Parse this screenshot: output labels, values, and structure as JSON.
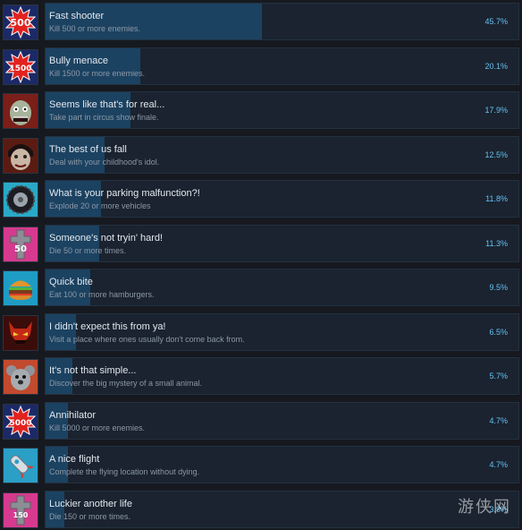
{
  "colors": {
    "background": "#16191f",
    "panel": "#1a232f",
    "progress_fill": "#1c4261",
    "title_text": "#e2e8ef",
    "description_text": "#8c98a6",
    "percent_text": "#66c0f4"
  },
  "achievements": [
    {
      "icon": "500-badge-icon",
      "icon_text": "500",
      "title": "Fast shooter",
      "description": "Kill 500 or more enemies.",
      "percent": "45.7%",
      "progress": 0.457
    },
    {
      "icon": "1500-badge-icon",
      "icon_text": "1500",
      "title": "Bully menace",
      "description": "Kill 1500 or more enemies.",
      "percent": "20.1%",
      "progress": 0.201
    },
    {
      "icon": "zombie-face-icon",
      "icon_text": "",
      "title": "Seems like that's for real...",
      "description": "Take part in circus show finale.",
      "percent": "17.9%",
      "progress": 0.179
    },
    {
      "icon": "vampire-face-icon",
      "icon_text": "",
      "title": "The best of us fall",
      "description": "Deal with your childhood's idol.",
      "percent": "12.5%",
      "progress": 0.125
    },
    {
      "icon": "tire-icon",
      "icon_text": "",
      "title": "What is your parking malfunction?!",
      "description": "Explode 20 or more vehicles",
      "percent": "11.8%",
      "progress": 0.118
    },
    {
      "icon": "tombstone-50-icon",
      "icon_text": "50",
      "title": "Someone's not tryin' hard!",
      "description": "Die 50 or more times.",
      "percent": "11.3%",
      "progress": 0.113
    },
    {
      "icon": "hamburger-icon",
      "icon_text": "",
      "title": "Quick bite",
      "description": "Eat 100 or more hamburgers.",
      "percent": "9.5%",
      "progress": 0.095
    },
    {
      "icon": "demon-face-icon",
      "icon_text": "",
      "title": "I didn't expect this from ya!",
      "description": "Visit a place where ones usually don't come back from.",
      "percent": "6.5%",
      "progress": 0.065
    },
    {
      "icon": "koala-icon",
      "icon_text": "",
      "title": "It's not that simple...",
      "description": "Discover the big mystery of a small animal.",
      "percent": "5.7%",
      "progress": 0.057
    },
    {
      "icon": "5000-badge-icon",
      "icon_text": "5000",
      "title": "Annihilator",
      "description": "Kill 5000 or more enemies.",
      "percent": "4.7%",
      "progress": 0.047
    },
    {
      "icon": "rocket-icon",
      "icon_text": "",
      "title": "A nice flight",
      "description": "Complete the flying location without dying.",
      "percent": "4.7%",
      "progress": 0.047
    },
    {
      "icon": "tombstone-150-icon",
      "icon_text": "150",
      "title": "Luckier another life",
      "description": "Die 150 or more times.",
      "percent": "3.9%",
      "progress": 0.039
    }
  ],
  "watermark": "游侠网"
}
